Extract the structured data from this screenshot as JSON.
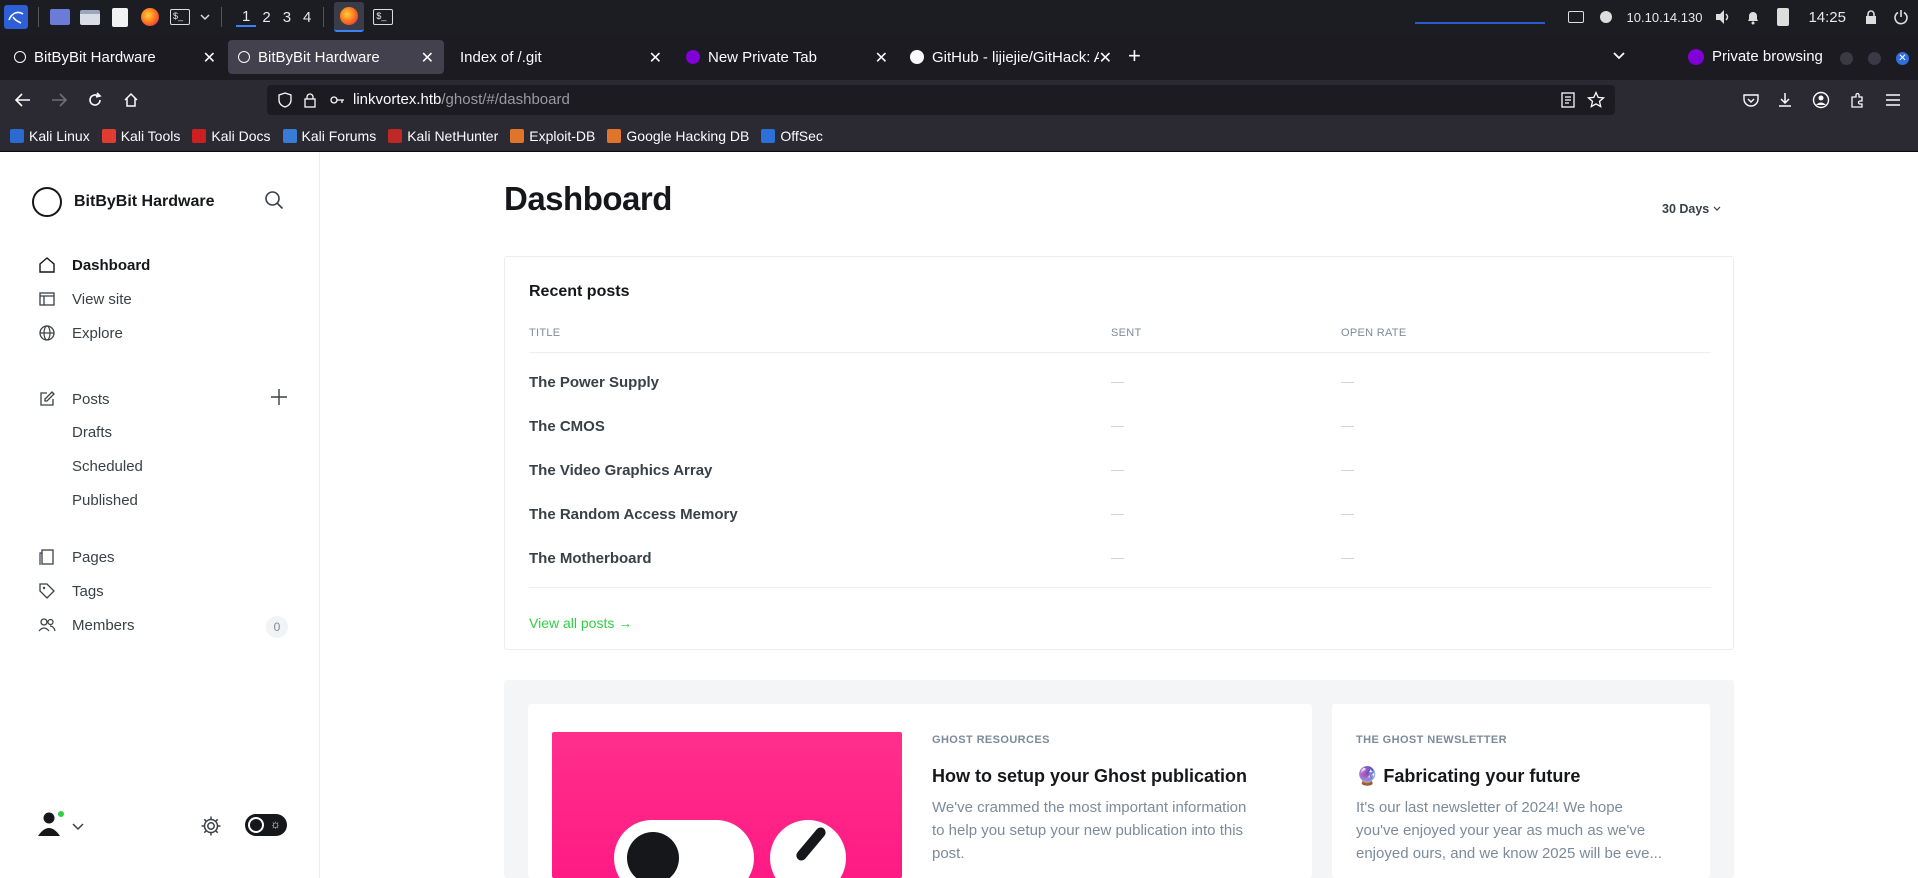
{
  "taskbar": {
    "workspaces": [
      "1",
      "2",
      "3",
      "4"
    ],
    "ip": "10.10.14.130",
    "clock": "14:25"
  },
  "browser": {
    "tabs": [
      {
        "title": "BitByBit Hardware",
        "selected": false
      },
      {
        "title": "BitByBit Hardware",
        "selected": true
      },
      {
        "title": "Index of /.git",
        "selected": false
      },
      {
        "title": "New Private Tab",
        "selected": false
      },
      {
        "title": "GitHub - lijiejie/GitHack: A",
        "selected": false
      }
    ],
    "private_label": "Private browsing",
    "url_host": "linkvortex.htb",
    "url_path": "/ghost/#/dashboard",
    "bookmarks": [
      {
        "label": "Kali Linux",
        "color": "#2b6ad1"
      },
      {
        "label": "Kali Tools",
        "color": "#e03c31"
      },
      {
        "label": "Kali Docs",
        "color": "#cc2020"
      },
      {
        "label": "Kali Forums",
        "color": "#3a7bd5"
      },
      {
        "label": "Kali NetHunter",
        "color": "#c02828"
      },
      {
        "label": "Exploit-DB",
        "color": "#e0742a"
      },
      {
        "label": "Google Hacking DB",
        "color": "#e0742a"
      },
      {
        "label": "OffSec",
        "color": "#2d6fd8"
      }
    ]
  },
  "sidebar": {
    "site_name": "BitByBit Hardware",
    "nav": [
      {
        "label": "Dashboard",
        "icon": "home-icon"
      },
      {
        "label": "View site",
        "icon": "view-site-icon"
      },
      {
        "label": "Explore",
        "icon": "globe-icon"
      }
    ],
    "posts": {
      "label": "Posts",
      "sub": [
        "Drafts",
        "Scheduled",
        "Published"
      ]
    },
    "pages_label": "Pages",
    "tags_label": "Tags",
    "members_label": "Members",
    "members_count": "0"
  },
  "main": {
    "title": "Dashboard",
    "range": "30 Days",
    "recent": {
      "title": "Recent posts",
      "columns": [
        "TITLE",
        "SENT",
        "OPEN RATE"
      ],
      "rows": [
        {
          "title": "The Power Supply",
          "sent": "—",
          "open_rate": "—"
        },
        {
          "title": "The CMOS",
          "sent": "—",
          "open_rate": "—"
        },
        {
          "title": "The Video Graphics Array",
          "sent": "—",
          "open_rate": "—"
        },
        {
          "title": "The Random Access Memory",
          "sent": "—",
          "open_rate": "—"
        },
        {
          "title": "The Motherboard",
          "sent": "—",
          "open_rate": "—"
        }
      ],
      "view_all": "View all posts →"
    },
    "resources": {
      "kicker": "GHOST RESOURCES",
      "title": "How to setup your Ghost publication",
      "body_lines": [
        "We've crammed the most important information",
        "to help you setup your new publication into this",
        "post."
      ]
    },
    "newsletter": {
      "kicker": "THE GHOST NEWSLETTER",
      "title": "🔮 Fabricating your future",
      "body_lines": [
        "It's our last newsletter of 2024! We hope",
        "you've enjoyed your year as much as we've",
        "enjoyed ours, and we know 2025 will be eve..."
      ]
    }
  },
  "colors": {
    "accent_green": "#30cf43",
    "pink": "#ff1a84"
  }
}
